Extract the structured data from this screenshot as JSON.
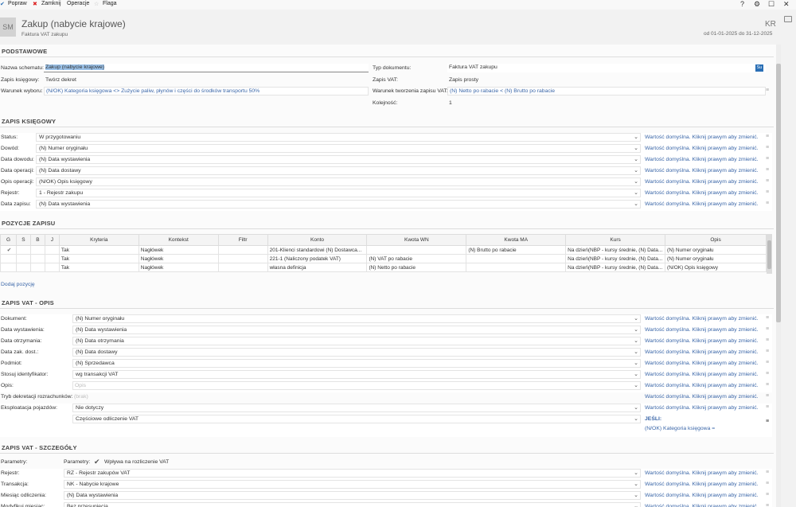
{
  "toolbar": {
    "popraw": "Popraw",
    "zamknij": "Zamknij",
    "operacje": "Operacje",
    "flaga": "Flaga"
  },
  "header": {
    "avatar": "SM",
    "title": "Zakup (nabycie krajowe)",
    "subtitle": "Faktura VAT zakupu",
    "code": "KR",
    "period": "od 01-01-2025 do 31-12-2025"
  },
  "basic": {
    "section": "PODSTAWOWE",
    "nazwa_label": "Nazwa schematu:",
    "nazwa_value": "Zakup (nabycie krajowe)",
    "zapis_label": "Zapis księgowy:",
    "zapis_value": "Twórz dekret",
    "warunek_label": "Warunek wyboru:",
    "warunek_value": "(N/OK) Kategoria księgowa <> Zużycie paliw, płynów i części do środków transportu 50%",
    "typ_label": "Typ dokumentu:",
    "typ_value": "Faktura VAT zakupu",
    "typ_btn": "Su",
    "zapisvat_label": "Zapis VAT:",
    "zapisvat_value": "Zapis prosty",
    "warunek2_label": "Warunek tworzenia zapisu VAT:",
    "warunek2_value": "(N) Netto po rabacie < (N) Brutto po rabacie",
    "kolejnosc_label": "Kolejność:",
    "kolejnosc_value": "1"
  },
  "zapis_ksiegowy": {
    "section": "ZAPIS KSIĘGOWY",
    "hint": "Wartość domyślna. Kliknij prawym aby zmienić.",
    "rows": [
      {
        "label": "Status:",
        "value": "W przygotowaniu"
      },
      {
        "label": "Dowód:",
        "value": "(N) Numer oryginału"
      },
      {
        "label": "Data dowodu:",
        "value": "(N) Data wystawienia"
      },
      {
        "label": "Data operacji:",
        "value": "(N) Data dostawy"
      },
      {
        "label": "Opis operacji:",
        "value": "(N/OK) Opis księgowy"
      },
      {
        "label": "Rejestr:",
        "value": "1 - Rejestr zakupu"
      },
      {
        "label": "Data zapisu:",
        "value": "(N) Data wystawienia"
      }
    ]
  },
  "pozycje": {
    "section": "POZYCJE ZAPISU",
    "columns": [
      "G",
      "S",
      "B",
      "J",
      "Kryteria",
      "Kontekst",
      "Filtr",
      "Konto",
      "Kwota WN",
      "Kwota MA",
      "Kurs",
      "Opis"
    ],
    "rows": [
      [
        "✔",
        "",
        "",
        "",
        "Tak",
        "Nagłówek",
        "",
        "201-Klienci standardowi (N) Dostawca...",
        "",
        "(N) Brutto po rabacie",
        "Na dzień(NBP - kursy średnie, (N) Data...",
        "(N) Numer oryginału"
      ],
      [
        "",
        "",
        "",
        "",
        "Tak",
        "Nagłówek",
        "",
        "221-1 (Naliczony podatek VAT)",
        "(N) VAT po rabacie",
        "",
        "Na dzień(NBP - kursy średnie, (N) Data...",
        "(N) Numer oryginału"
      ],
      [
        "",
        "",
        "",
        "",
        "Tak",
        "Nagłówek",
        "",
        "własna definicja",
        "(N) Netto po rabacie",
        "",
        "Na dzień(NBP - kursy średnie, (N) Data...",
        "(N/OK) Opis księgowy"
      ]
    ],
    "add": "Dodaj pozycję"
  },
  "vat_opis": {
    "section": "ZAPIS VAT - OPIS",
    "hint": "Wartość domyślna. Kliknij prawym aby zmienić.",
    "rows": [
      {
        "label": "Dokument:",
        "value": "(N) Numer oryginału"
      },
      {
        "label": "Data wystawienia:",
        "value": "(N) Data wystawienia"
      },
      {
        "label": "Data otrzymania:",
        "value": "(N) Data otrzymania"
      },
      {
        "label": "Data zak. dost.:",
        "value": "(N) Data dostawy"
      },
      {
        "label": "Podmiot:",
        "value": "(N) Sprzedawca"
      },
      {
        "label": "Stosuj identyfikator:",
        "value": "wg transakcji VAT"
      }
    ],
    "opis_label": "Opis:",
    "opis_placeholder": "Opis",
    "tryb_label": "Tryb dekretacji rozrachunków:",
    "tryb_value": "(brak)",
    "eksp_label": "Eksploatacja pojazdów:",
    "eksp_value": "Nie dotyczy",
    "eksp2_value": "Częściowe odliczenie VAT",
    "jesli": "JEŚLI:",
    "jesli_cond": "(N/OK) Kategoria księgowa ="
  },
  "vat_szczegoly": {
    "section": "ZAPIS VAT - SZCZEGÓŁY",
    "param_label": "Parametry:",
    "param_label2": "Parametry:",
    "param_check": "Wpływa na rozliczenie VAT",
    "hint": "Wartość domyślna. Kliknij prawym aby zmienić.",
    "rows": [
      {
        "label": "Rejestr:",
        "value": "RZ - Rejestr zakupów VAT"
      },
      {
        "label": "Transakcja:",
        "value": "NK - Nabycie krajowe"
      },
      {
        "label": "Miesiąc odliczenia:",
        "value": "(N) Data wystawienia"
      },
      {
        "label": "Modyfikuj miesiąc:",
        "value": "Bez przesunięcia"
      }
    ]
  }
}
